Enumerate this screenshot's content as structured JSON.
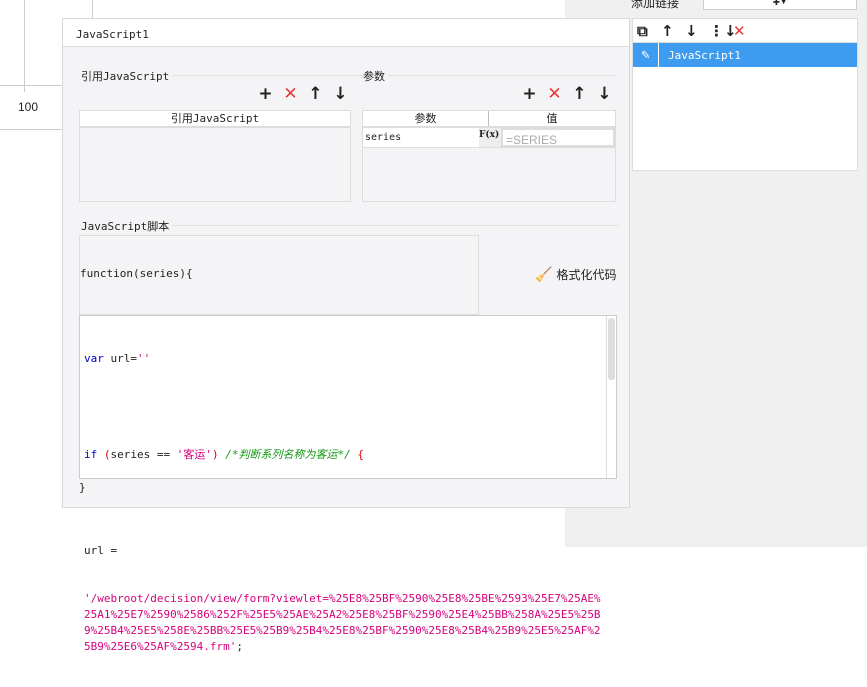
{
  "background": {
    "axis_label": "100"
  },
  "right_panel": {
    "add_link_label": "添加链接",
    "toolbar": [
      "copy-icon",
      "arrow-up-icon",
      "arrow-down-icon",
      "sort-icon",
      "delete-icon"
    ],
    "items": [
      {
        "label": "JavaScript1",
        "selected": true
      }
    ]
  },
  "dialog": {
    "title": "JavaScript1",
    "ref_section": {
      "title": "引用JavaScript",
      "column": "引用JavaScript"
    },
    "param_section": {
      "title": "参数",
      "columns": [
        "参数",
        "值"
      ],
      "rows": [
        {
          "name": "series",
          "formula_label": "F(x)",
          "value_placeholder": "=SERIES"
        }
      ]
    },
    "script_section": {
      "title": "JavaScript脚本",
      "header": "function(series){",
      "format_button": "格式化代码",
      "code": {
        "l1_kw": "var",
        "l1_rest": " url=",
        "l1_str": "''",
        "l2_kw": "if",
        "l2_p1": " (",
        "l2_var": "series == ",
        "l2_str": "'客运'",
        "l2_p2": ") ",
        "l2_cm": "/*判断系列名称为客运*/",
        "l2_brace": " {",
        "l3": "url =",
        "l4_str": "'/webroot/decision/view/form?viewlet=%25E8%25BF%2590%25E8%25BE%2593%25E7%25AE%25A1%25E7%2590%2586%252F%25E5%25AE%25A2%25E8%25BF%2590%25E4%25BB%258A%25E5%25B9%25B4%25E5%258E%25BB%25E5%25B9%25B4%25E8%25BF%2590%25E8%25B4%25B9%25E5%25AF%25B9%25E6%25AF%2594.frm'",
        "l4_end": ";"
      },
      "footer": "}"
    }
  },
  "colors": {
    "accent": "#3d9bf0",
    "danger": "#e53935"
  }
}
